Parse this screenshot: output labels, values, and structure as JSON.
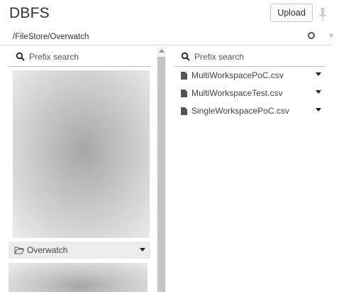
{
  "header": {
    "title": "DBFS",
    "upload_label": "Upload"
  },
  "path": "/FileStore/Overwatch",
  "left_panel": {
    "search_placeholder": "Prefix search",
    "folder": "Overwatch"
  },
  "right_panel": {
    "search_placeholder": "Prefix search",
    "files": [
      "MultiWorkspacePoC.csv",
      "MultiWorkspaceTest.csv",
      "SingleWorkspacePoC.csv"
    ]
  }
}
